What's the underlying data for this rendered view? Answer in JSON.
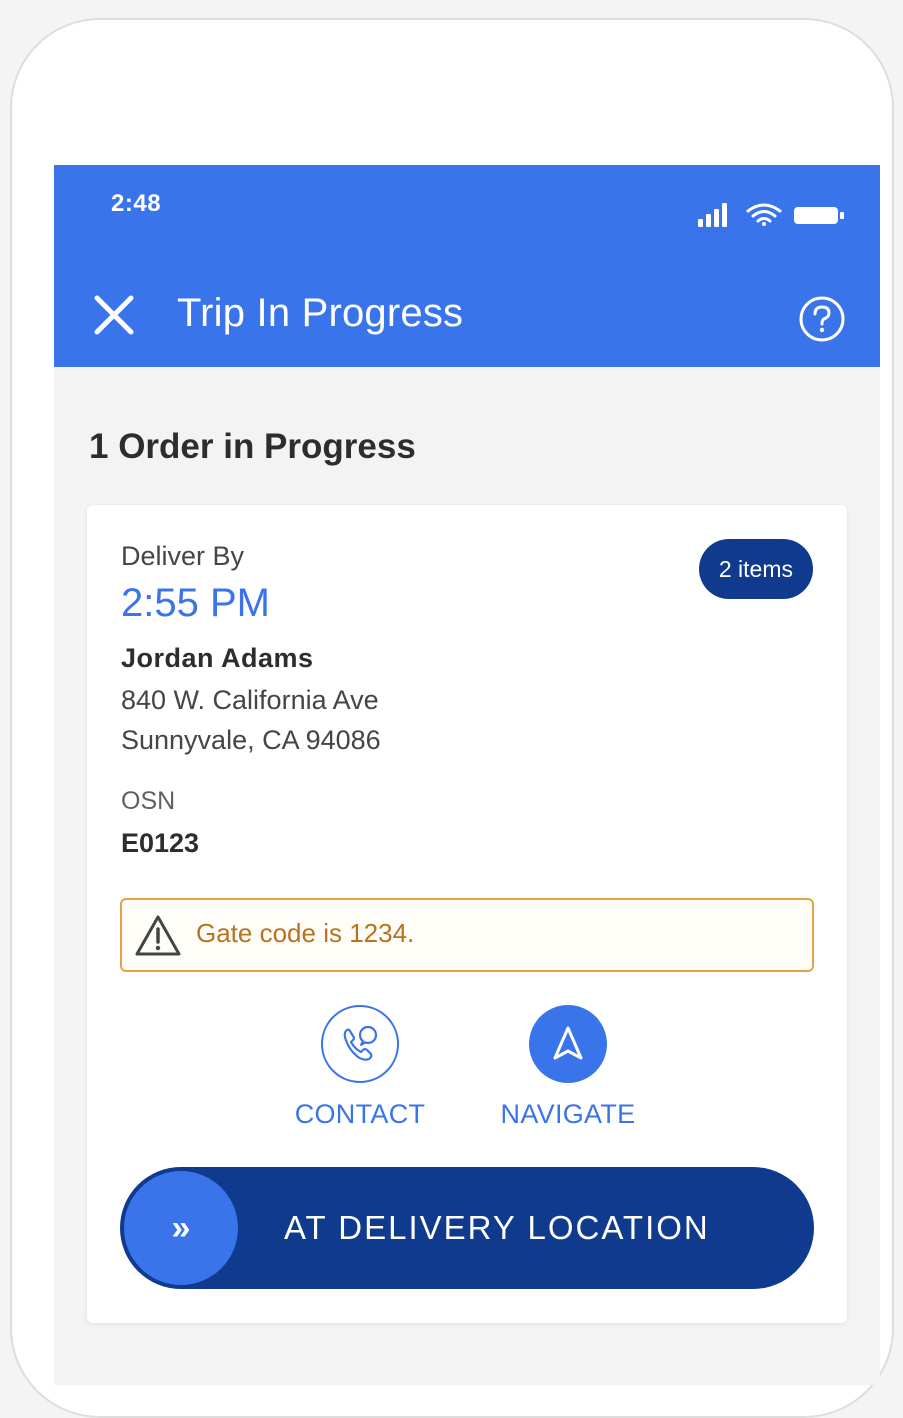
{
  "status_bar": {
    "time": "2:48"
  },
  "header": {
    "title": "Trip In Progress",
    "close_icon": "close-icon",
    "help_icon": "help-circle-icon"
  },
  "section": {
    "heading": "1 Order in Progress"
  },
  "order": {
    "deliver_by_label": "Deliver By",
    "deliver_by_time": "2:55 PM",
    "items_badge": "2 items",
    "customer_name": "Jordan Adams",
    "address_line1": "840 W. California Ave",
    "address_line2": "Sunnyvale, CA 94086",
    "osn_label": "OSN",
    "osn_value": "E0123",
    "alert_text": "Gate code is 1234."
  },
  "actions": {
    "contact_label": "CONTACT",
    "navigate_label": "NAVIGATE"
  },
  "slider": {
    "handle_symbol": "»",
    "label": "AT DELIVERY LOCATION"
  },
  "colors": {
    "primary": "#3a74ea",
    "dark_primary": "#0f3a8e",
    "warning": "#e2a247"
  }
}
